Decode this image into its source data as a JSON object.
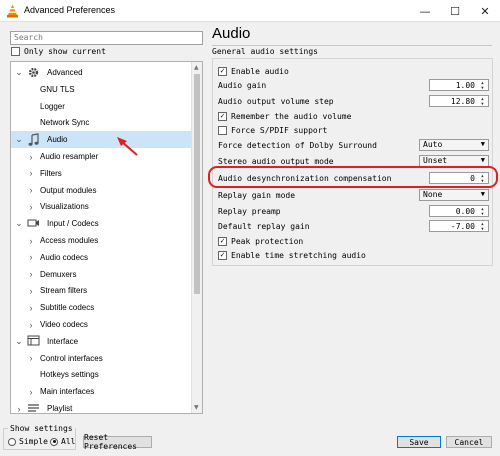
{
  "window": {
    "title": "Advanced Preferences",
    "minimize": "—",
    "maximize": "☐",
    "close": "✕"
  },
  "search": {
    "placeholder": "Search"
  },
  "only_show_current": {
    "label": "Only show current",
    "checked": false
  },
  "tree": [
    {
      "label": "Advanced",
      "level": 0,
      "expand": "v",
      "icon": "gear-icon"
    },
    {
      "label": "GNU TLS",
      "level": 1,
      "expand": ""
    },
    {
      "label": "Logger",
      "level": 1,
      "expand": ""
    },
    {
      "label": "Network Sync",
      "level": 1,
      "expand": ""
    },
    {
      "label": "Audio",
      "level": 0,
      "expand": "v",
      "icon": "music-note-icon",
      "selected": true
    },
    {
      "label": "Audio resampler",
      "level": 1,
      "expand": ">"
    },
    {
      "label": "Filters",
      "level": 1,
      "expand": ">"
    },
    {
      "label": "Output modules",
      "level": 1,
      "expand": ">"
    },
    {
      "label": "Visualizations",
      "level": 1,
      "expand": ">"
    },
    {
      "label": "Input / Codecs",
      "level": 0,
      "expand": "v",
      "icon": "codecs-icon"
    },
    {
      "label": "Access modules",
      "level": 1,
      "expand": ">"
    },
    {
      "label": "Audio codecs",
      "level": 1,
      "expand": ">"
    },
    {
      "label": "Demuxers",
      "level": 1,
      "expand": ">"
    },
    {
      "label": "Stream filters",
      "level": 1,
      "expand": ">"
    },
    {
      "label": "Subtitle codecs",
      "level": 1,
      "expand": ">"
    },
    {
      "label": "Video codecs",
      "level": 1,
      "expand": ">"
    },
    {
      "label": "Interface",
      "level": 0,
      "expand": "v",
      "icon": "interface-icon"
    },
    {
      "label": "Control interfaces",
      "level": 1,
      "expand": ">"
    },
    {
      "label": "Hotkeys settings",
      "level": 1,
      "expand": ""
    },
    {
      "label": "Main interfaces",
      "level": 1,
      "expand": ">"
    },
    {
      "label": "Playlist",
      "level": 0,
      "expand": ">",
      "icon": "playlist-icon"
    }
  ],
  "panel": {
    "title": "Audio",
    "section": "General audio settings",
    "enable_audio": "Enable audio",
    "audio_gain": {
      "label": "Audio gain",
      "value": "1.00"
    },
    "volume_step": {
      "label": "Audio output volume step",
      "value": "12.80"
    },
    "remember_volume": "Remember the audio volume",
    "force_spdif": "Force S/PDIF support",
    "dolby": {
      "label": "Force detection of Dolby Surround",
      "value": "Auto"
    },
    "stereo_mode": {
      "label": "Stereo audio output mode",
      "value": "Unset"
    },
    "desync": {
      "label": "Audio desynchronization compensation",
      "value": "0"
    },
    "replay_mode": {
      "label": "Replay gain mode",
      "value": "None"
    },
    "replay_preamp": {
      "label": "Replay preamp",
      "value": "0.00"
    },
    "default_replay": {
      "label": "Default replay gain",
      "value": "-7.00"
    },
    "peak": "Peak protection",
    "time_stretch": "Enable time stretching audio"
  },
  "show_settings": {
    "legend": "Show settings",
    "simple": "Simple",
    "all": "All",
    "selected": "All"
  },
  "buttons": {
    "reset": "Reset Preferences",
    "save": "Save",
    "cancel": "Cancel"
  },
  "colors": {
    "selection": "#cce4f7",
    "highlight_ring": "#e0201f",
    "arrow": "#e0201f"
  }
}
